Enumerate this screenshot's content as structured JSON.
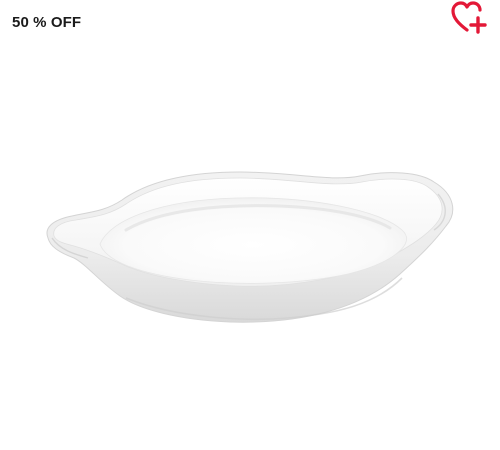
{
  "card": {
    "discount_label": "50 % OFF",
    "accent_color": "#e31837"
  },
  "icons": {
    "wishlist": "heart-plus-icon",
    "product": "oval-baking-dish-image"
  }
}
